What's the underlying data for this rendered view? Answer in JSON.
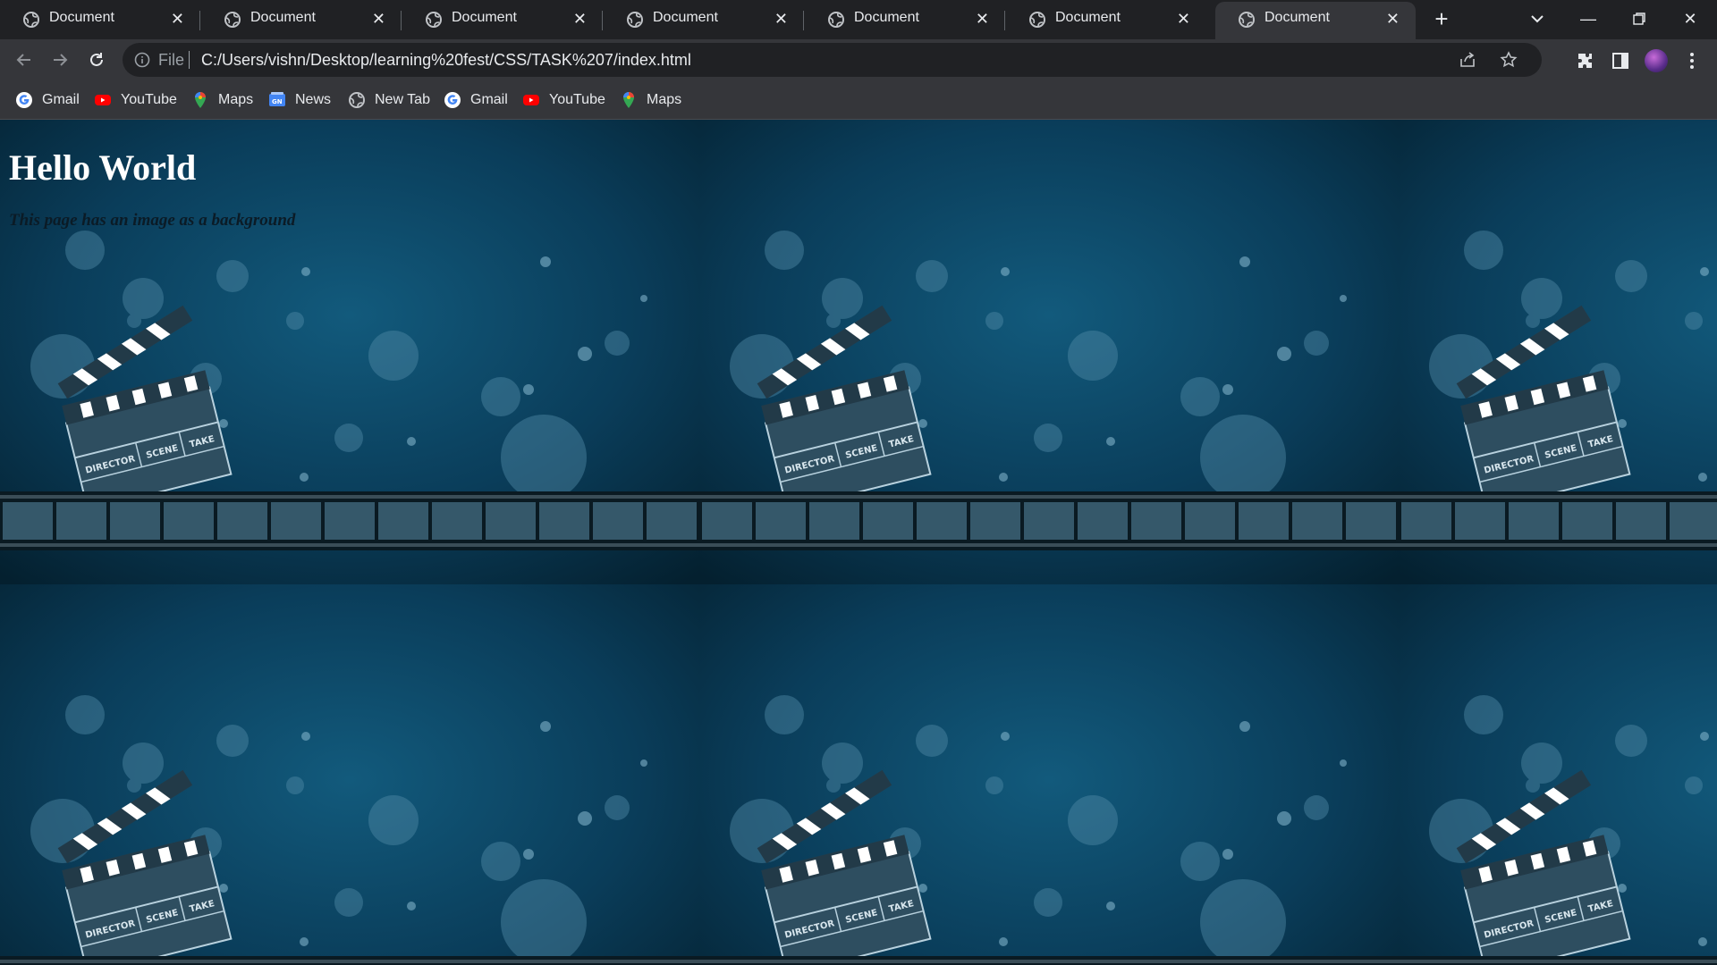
{
  "browser": {
    "tabs": [
      {
        "title": "Document",
        "active": false
      },
      {
        "title": "Document",
        "active": false
      },
      {
        "title": "Document",
        "active": false
      },
      {
        "title": "Document",
        "active": false
      },
      {
        "title": "Document",
        "active": false
      },
      {
        "title": "Document",
        "active": false
      },
      {
        "title": "Document",
        "active": true
      }
    ],
    "address": {
      "scheme_label": "File",
      "url": "C:/Users/vishn/Desktop/learning%20fest/CSS/TASK%207/index.html"
    },
    "bookmarks": [
      {
        "label": "Gmail",
        "icon": "google-icon"
      },
      {
        "label": "YouTube",
        "icon": "youtube-icon"
      },
      {
        "label": "Maps",
        "icon": "maps-icon"
      },
      {
        "label": "News",
        "icon": "news-icon"
      },
      {
        "label": "New Tab",
        "icon": "globe-icon"
      },
      {
        "label": "Gmail",
        "icon": "google-icon"
      },
      {
        "label": "YouTube",
        "icon": "youtube-icon"
      },
      {
        "label": "Maps",
        "icon": "maps-icon"
      }
    ]
  },
  "page": {
    "heading": "Hello World",
    "paragraph": "This page has an image as a background",
    "background_tile": {
      "clapper_labels": [
        "DIRECTOR",
        "SCENE",
        "TAKE"
      ],
      "base_color": "#0b3a55",
      "accent_color": "#1a5a7a"
    }
  },
  "colors": {
    "tabstrip": "#202124",
    "toolbar": "#35363a",
    "text": "#e8eaed"
  }
}
